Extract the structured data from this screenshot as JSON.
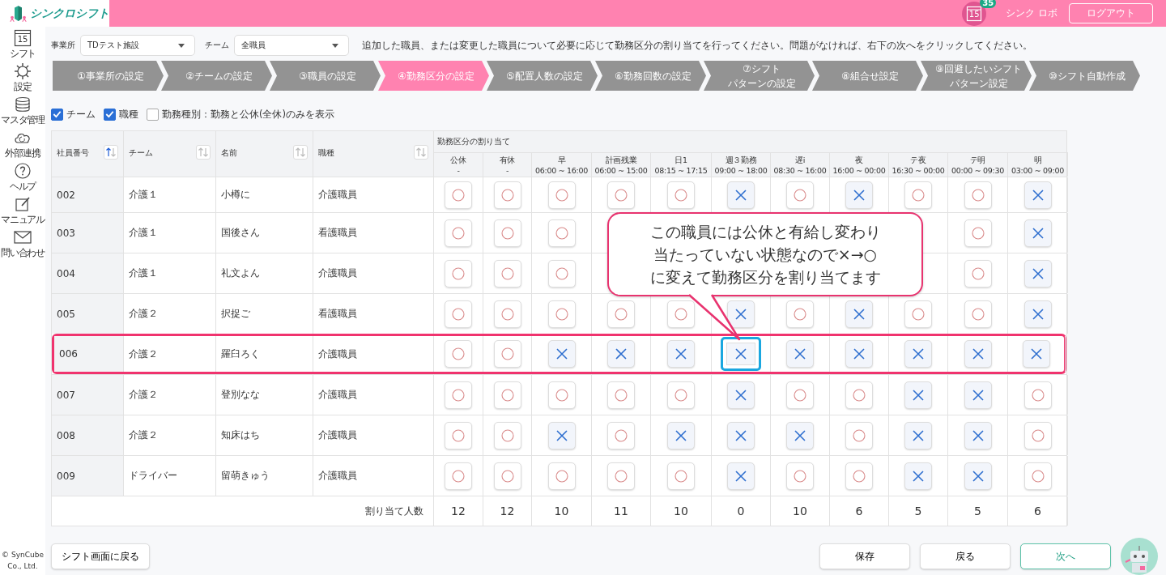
{
  "header": {
    "logo_text": "シンクロシフト",
    "calendar_day": "15",
    "notification_count": "35",
    "user_name": "シンク ロボ",
    "logout_button": "ログアウト"
  },
  "sidebar": {
    "items": [
      {
        "kind": "calendar",
        "label": "シフト",
        "day": "15"
      },
      {
        "kind": "gear",
        "label": "設定"
      },
      {
        "kind": "database",
        "label": "マスタ管理"
      },
      {
        "kind": "cloud",
        "label": "外部連携"
      },
      {
        "kind": "help",
        "label": "ヘルプ"
      },
      {
        "kind": "note",
        "label": "マニュアル"
      },
      {
        "kind": "mail",
        "label": "問い合わせ"
      }
    ],
    "copyright": "© SynCube\nCo., Ltd."
  },
  "filters": [
    {
      "label": "事業所",
      "value": "TDテスト施設"
    },
    {
      "label": "チーム",
      "value": "全職員"
    }
  ],
  "instruction": "追加した職員、または変更した職員について必要に応じて勤務区分の割り当てを行ってください。問題がなければ、右下の次へをクリックしてください。",
  "steps": [
    {
      "lines": [
        "①事業所の設定"
      ],
      "selected": false
    },
    {
      "lines": [
        "②チームの設定"
      ],
      "selected": false
    },
    {
      "lines": [
        "③職員の設定"
      ],
      "selected": false
    },
    {
      "lines": [
        "④勤務区分の設定"
      ],
      "selected": true
    },
    {
      "lines": [
        "⑤配置人数の設定"
      ],
      "selected": false
    },
    {
      "lines": [
        "⑥勤務回数の設定"
      ],
      "selected": false
    },
    {
      "lines": [
        "⑦シフト",
        "パターンの設定"
      ],
      "selected": false
    },
    {
      "lines": [
        "⑧組合せ設定"
      ],
      "selected": false
    },
    {
      "lines": [
        "⑨回避したいシフト",
        "パターン設定"
      ],
      "selected": false
    },
    {
      "lines": [
        "⑩シフト自動作成"
      ],
      "selected": false
    }
  ],
  "options": [
    {
      "label": "チーム",
      "checked": true
    },
    {
      "label": "職種",
      "checked": true
    },
    {
      "label": "勤務種別：勤務と公休(全休)のみを表示",
      "checked": false
    }
  ],
  "table": {
    "columns": [
      {
        "label": "社員番号",
        "sort_active": true
      },
      {
        "label": "チーム",
        "sort_active": false
      },
      {
        "label": "名前",
        "sort_active": false
      },
      {
        "label": "職種",
        "sort_active": false
      }
    ],
    "group_label": "勤務区分の割り当て",
    "shift_columns": [
      {
        "name": "公休",
        "time": "-"
      },
      {
        "name": "有休",
        "time": "-"
      },
      {
        "name": "早",
        "time": "06:00 ~ 16:00"
      },
      {
        "name": "計画残業",
        "time": "06:00 ~ 15:00"
      },
      {
        "name": "日1",
        "time": "08:15 ~ 17:15"
      },
      {
        "name": "週３勤務",
        "time": "09:00 ~ 18:00"
      },
      {
        "name": "遅i",
        "time": "08:30 ~ 16:00"
      },
      {
        "name": "夜",
        "time": "16:00 ~ 00:00"
      },
      {
        "name": "テ夜",
        "time": "16:30 ~ 00:00"
      },
      {
        "name": "テ明",
        "time": "00:00 ~ 09:30"
      },
      {
        "name": "明",
        "time": "03:00 ~ 09:00"
      }
    ],
    "rows": [
      {
        "id": "002",
        "team": "介護１",
        "name": "小樽に",
        "job": "介護職員",
        "highlighted": false,
        "cells": [
          {
            "assigned": true,
            "focused": false
          },
          {
            "assigned": true,
            "focused": false
          },
          {
            "assigned": true,
            "focused": false
          },
          {
            "assigned": true,
            "focused": false
          },
          {
            "assigned": true,
            "focused": false
          },
          {
            "assigned": false,
            "focused": false
          },
          {
            "assigned": true,
            "focused": false
          },
          {
            "assigned": false,
            "focused": false
          },
          {
            "assigned": true,
            "focused": false
          },
          {
            "assigned": true,
            "focused": false
          },
          {
            "assigned": false,
            "focused": false
          }
        ]
      },
      {
        "id": "003",
        "team": "介護１",
        "name": "国後さん",
        "job": "看護職員",
        "highlighted": false,
        "cells": [
          {
            "assigned": true,
            "focused": false
          },
          {
            "assigned": true,
            "focused": false
          },
          {
            "assigned": true,
            "focused": false
          },
          null,
          null,
          null,
          null,
          null,
          null,
          {
            "assigned": true,
            "focused": false
          },
          {
            "assigned": false,
            "focused": false
          }
        ]
      },
      {
        "id": "004",
        "team": "介護１",
        "name": "礼文よん",
        "job": "介護職員",
        "highlighted": false,
        "cells": [
          {
            "assigned": true,
            "focused": false
          },
          {
            "assigned": true,
            "focused": false
          },
          {
            "assigned": true,
            "focused": false
          },
          null,
          null,
          null,
          null,
          null,
          null,
          {
            "assigned": true,
            "focused": false
          },
          {
            "assigned": false,
            "focused": false
          }
        ]
      },
      {
        "id": "005",
        "team": "介護２",
        "name": "択捉ご",
        "job": "看護職員",
        "highlighted": false,
        "cells": [
          {
            "assigned": true,
            "focused": false
          },
          {
            "assigned": true,
            "focused": false
          },
          {
            "assigned": true,
            "focused": false
          },
          {
            "assigned": true,
            "focused": false
          },
          {
            "assigned": true,
            "focused": false
          },
          {
            "assigned": false,
            "focused": false
          },
          {
            "assigned": true,
            "focused": false
          },
          {
            "assigned": false,
            "focused": false
          },
          {
            "assigned": true,
            "focused": false
          },
          {
            "assigned": true,
            "focused": false
          },
          {
            "assigned": false,
            "focused": false
          }
        ]
      },
      {
        "id": "006",
        "team": "介護２",
        "name": "羅臼ろく",
        "job": "介護職員",
        "highlighted": true,
        "cells": [
          {
            "assigned": true,
            "focused": false
          },
          {
            "assigned": true,
            "focused": false
          },
          {
            "assigned": false,
            "focused": false
          },
          {
            "assigned": false,
            "focused": false
          },
          {
            "assigned": false,
            "focused": false
          },
          {
            "assigned": false,
            "focused": true
          },
          {
            "assigned": false,
            "focused": false
          },
          {
            "assigned": false,
            "focused": false
          },
          {
            "assigned": false,
            "focused": false
          },
          {
            "assigned": false,
            "focused": false
          },
          {
            "assigned": false,
            "focused": false
          }
        ]
      },
      {
        "id": "007",
        "team": "介護２",
        "name": "登別なな",
        "job": "介護職員",
        "highlighted": false,
        "cells": [
          {
            "assigned": true,
            "focused": false
          },
          {
            "assigned": true,
            "focused": false
          },
          {
            "assigned": true,
            "focused": false
          },
          {
            "assigned": true,
            "focused": false
          },
          {
            "assigned": true,
            "focused": false
          },
          {
            "assigned": false,
            "focused": false
          },
          {
            "assigned": true,
            "focused": false
          },
          {
            "assigned": true,
            "focused": false
          },
          {
            "assigned": false,
            "focused": false
          },
          {
            "assigned": false,
            "focused": false
          },
          {
            "assigned": true,
            "focused": false
          }
        ]
      },
      {
        "id": "008",
        "team": "介護２",
        "name": "知床はち",
        "job": "介護職員",
        "highlighted": false,
        "cells": [
          {
            "assigned": true,
            "focused": false
          },
          {
            "assigned": true,
            "focused": false
          },
          {
            "assigned": false,
            "focused": false
          },
          {
            "assigned": true,
            "focused": false
          },
          {
            "assigned": false,
            "focused": false
          },
          {
            "assigned": false,
            "focused": false
          },
          {
            "assigned": false,
            "focused": false
          },
          {
            "assigned": true,
            "focused": false
          },
          {
            "assigned": false,
            "focused": false
          },
          {
            "assigned": false,
            "focused": false
          },
          {
            "assigned": true,
            "focused": false
          }
        ]
      },
      {
        "id": "009",
        "team": "ドライバー",
        "name": "留萌きゅう",
        "job": "介護職員",
        "highlighted": false,
        "cells": [
          {
            "assigned": true,
            "focused": false
          },
          {
            "assigned": true,
            "focused": false
          },
          {
            "assigned": true,
            "focused": false
          },
          {
            "assigned": true,
            "focused": false
          },
          {
            "assigned": true,
            "focused": false
          },
          {
            "assigned": false,
            "focused": false
          },
          {
            "assigned": true,
            "focused": false
          },
          {
            "assigned": true,
            "focused": false
          },
          {
            "assigned": false,
            "focused": false
          },
          {
            "assigned": false,
            "focused": false
          },
          {
            "assigned": true,
            "focused": false
          }
        ]
      }
    ],
    "total_label": "割り当て人数",
    "totals": [
      "12",
      "12",
      "10",
      "11",
      "10",
      "0",
      "10",
      "6",
      "5",
      "5",
      "6"
    ]
  },
  "callout": {
    "lines": [
      "この職員には公休と有給し変わり",
      "当たっていない状態なので×→○",
      "に変えて勤務区分を割り当てます"
    ]
  },
  "buttons": {
    "back_to_shift": "シフト画面に戻る",
    "save": "保存",
    "back": "戻る",
    "next": "次へ"
  }
}
